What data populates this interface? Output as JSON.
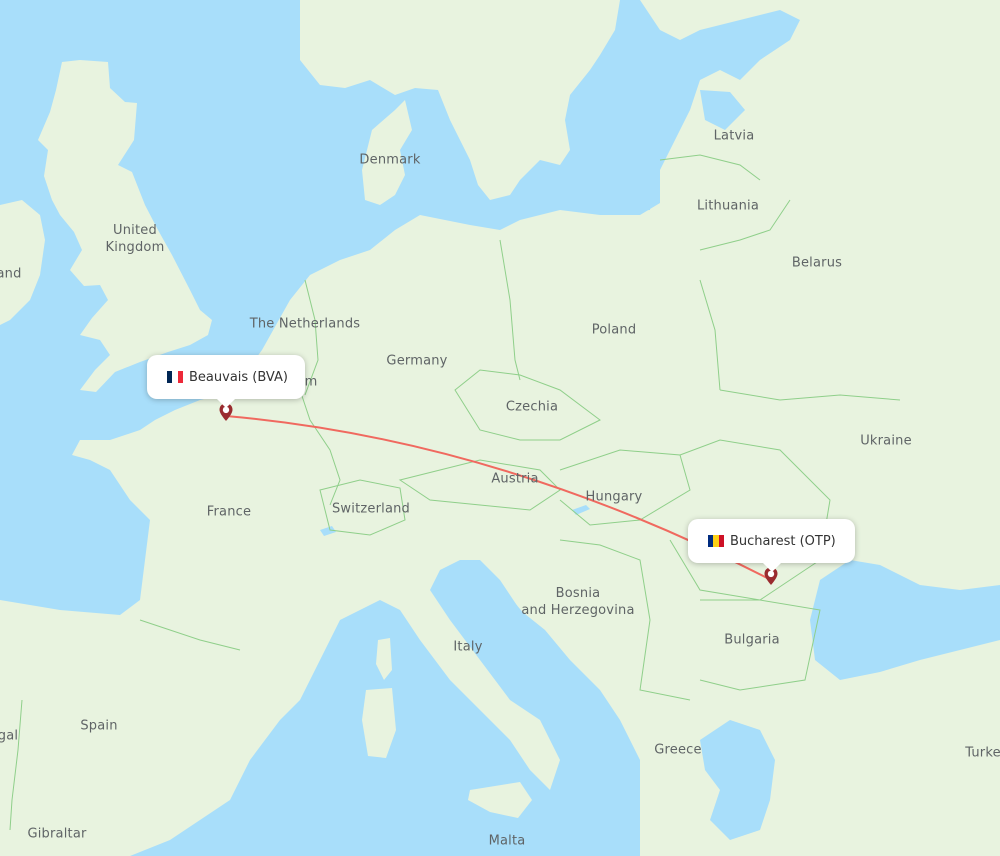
{
  "map": {
    "colors": {
      "water": "#a8defa",
      "land": "#e8f3df",
      "land_dark": "#dcebd0",
      "border": "#8fcf8a",
      "route": "#f0695f",
      "marker": "#9a2b2f"
    },
    "country_labels": [
      {
        "id": "united-kingdom",
        "text": "United\nKingdom"
      },
      {
        "id": "ireland",
        "text": "and"
      },
      {
        "id": "denmark",
        "text": "Denmark"
      },
      {
        "id": "latvia",
        "text": "Latvia"
      },
      {
        "id": "lithuania",
        "text": "Lithuania"
      },
      {
        "id": "belarus",
        "text": "Belarus"
      },
      {
        "id": "the-netherlands",
        "text": "The Netherlands"
      },
      {
        "id": "germany",
        "text": "Germany"
      },
      {
        "id": "poland",
        "text": "Poland"
      },
      {
        "id": "belgium",
        "text": "m"
      },
      {
        "id": "czechia",
        "text": "Czechia"
      },
      {
        "id": "ukraine",
        "text": "Ukraine"
      },
      {
        "id": "austria",
        "text": "Austria"
      },
      {
        "id": "hungary",
        "text": "Hungary"
      },
      {
        "id": "france",
        "text": "France"
      },
      {
        "id": "switzerland",
        "text": "Switzerland"
      },
      {
        "id": "bosnia-and-herzegovina",
        "text": "Bosnia\nand Herzegovina"
      },
      {
        "id": "bulgaria",
        "text": "Bulgaria"
      },
      {
        "id": "italy",
        "text": "Italy"
      },
      {
        "id": "spain",
        "text": "Spain"
      },
      {
        "id": "portugal",
        "text": "gal"
      },
      {
        "id": "greece",
        "text": "Greece"
      },
      {
        "id": "turkey",
        "text": "Turke"
      },
      {
        "id": "gibraltar",
        "text": "Gibraltar"
      },
      {
        "id": "malta",
        "text": "Malta"
      }
    ],
    "route": {
      "origin": {
        "city": "Beauvais",
        "code": "BVA",
        "label": "Beauvais (BVA)",
        "flag": "france-flag",
        "flag_colors": [
          "#002654",
          "#ffffff",
          "#ed2939"
        ]
      },
      "destination": {
        "city": "Bucharest",
        "code": "OTP",
        "label": "Bucharest (OTP)",
        "flag": "romania-flag",
        "flag_colors": [
          "#002b7f",
          "#fcd116",
          "#ce1126"
        ]
      }
    }
  }
}
